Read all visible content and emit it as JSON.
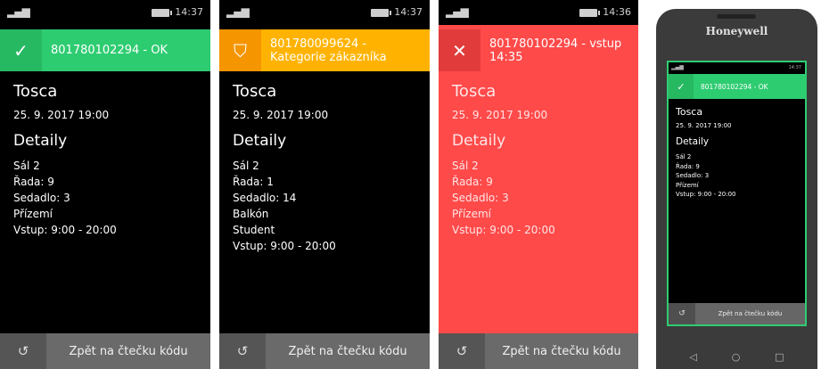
{
  "screens": [
    {
      "time": "14:37",
      "header": "801780102294 - OK",
      "icon": "check-icon",
      "accent": "#2ecc71",
      "title": "Tosca",
      "datetime": "25. 9. 2017 19:00",
      "details_heading": "Detaily",
      "lines": [
        "Sál 2",
        "Řada: 9",
        "Sedadlo: 3",
        "Přízemí",
        "Vstup: 9:00 - 20:00"
      ],
      "back_label": "Zpět na čtečku kódu"
    },
    {
      "time": "14:37",
      "header": "801780099624 - Kategorie zákazníka",
      "icon": "shield-icon",
      "accent": "#ffb300",
      "title": "Tosca",
      "datetime": "25. 9. 2017 19:00",
      "details_heading": "Detaily",
      "lines": [
        "Sál 2",
        "Řada: 1",
        "Sedadlo: 14",
        "Balkón",
        "Student",
        "Vstup: 9:00 - 20:00"
      ],
      "back_label": "Zpět na čtečku kódu"
    },
    {
      "time": "14:36",
      "header": "801780102294 - vstup 14:35",
      "icon": "close-icon",
      "accent": "#ff4a4a",
      "title": "Tosca",
      "datetime": "25. 9. 2017 19:00",
      "details_heading": "Detaily",
      "lines": [
        "Sál 2",
        "Řada: 9",
        "Sedadlo: 3",
        "Přízemí",
        "Vstup: 9:00 - 20:00"
      ],
      "back_label": "Zpět na čtečku kódu"
    }
  ],
  "phone": {
    "brand": "Honeywell",
    "time": "14:37",
    "header": "801780102294 - OK",
    "title": "Tosca",
    "datetime": "25. 9. 2017 19:00",
    "details_heading": "Detaily",
    "lines": [
      "Sál 2",
      "Řada: 9",
      "Sedadlo: 3",
      "Přízemí",
      "Vstup: 9:00 - 20:00"
    ],
    "back_label": "Zpět na čtečku kódu",
    "nav": [
      "◁",
      "○",
      "□"
    ]
  }
}
